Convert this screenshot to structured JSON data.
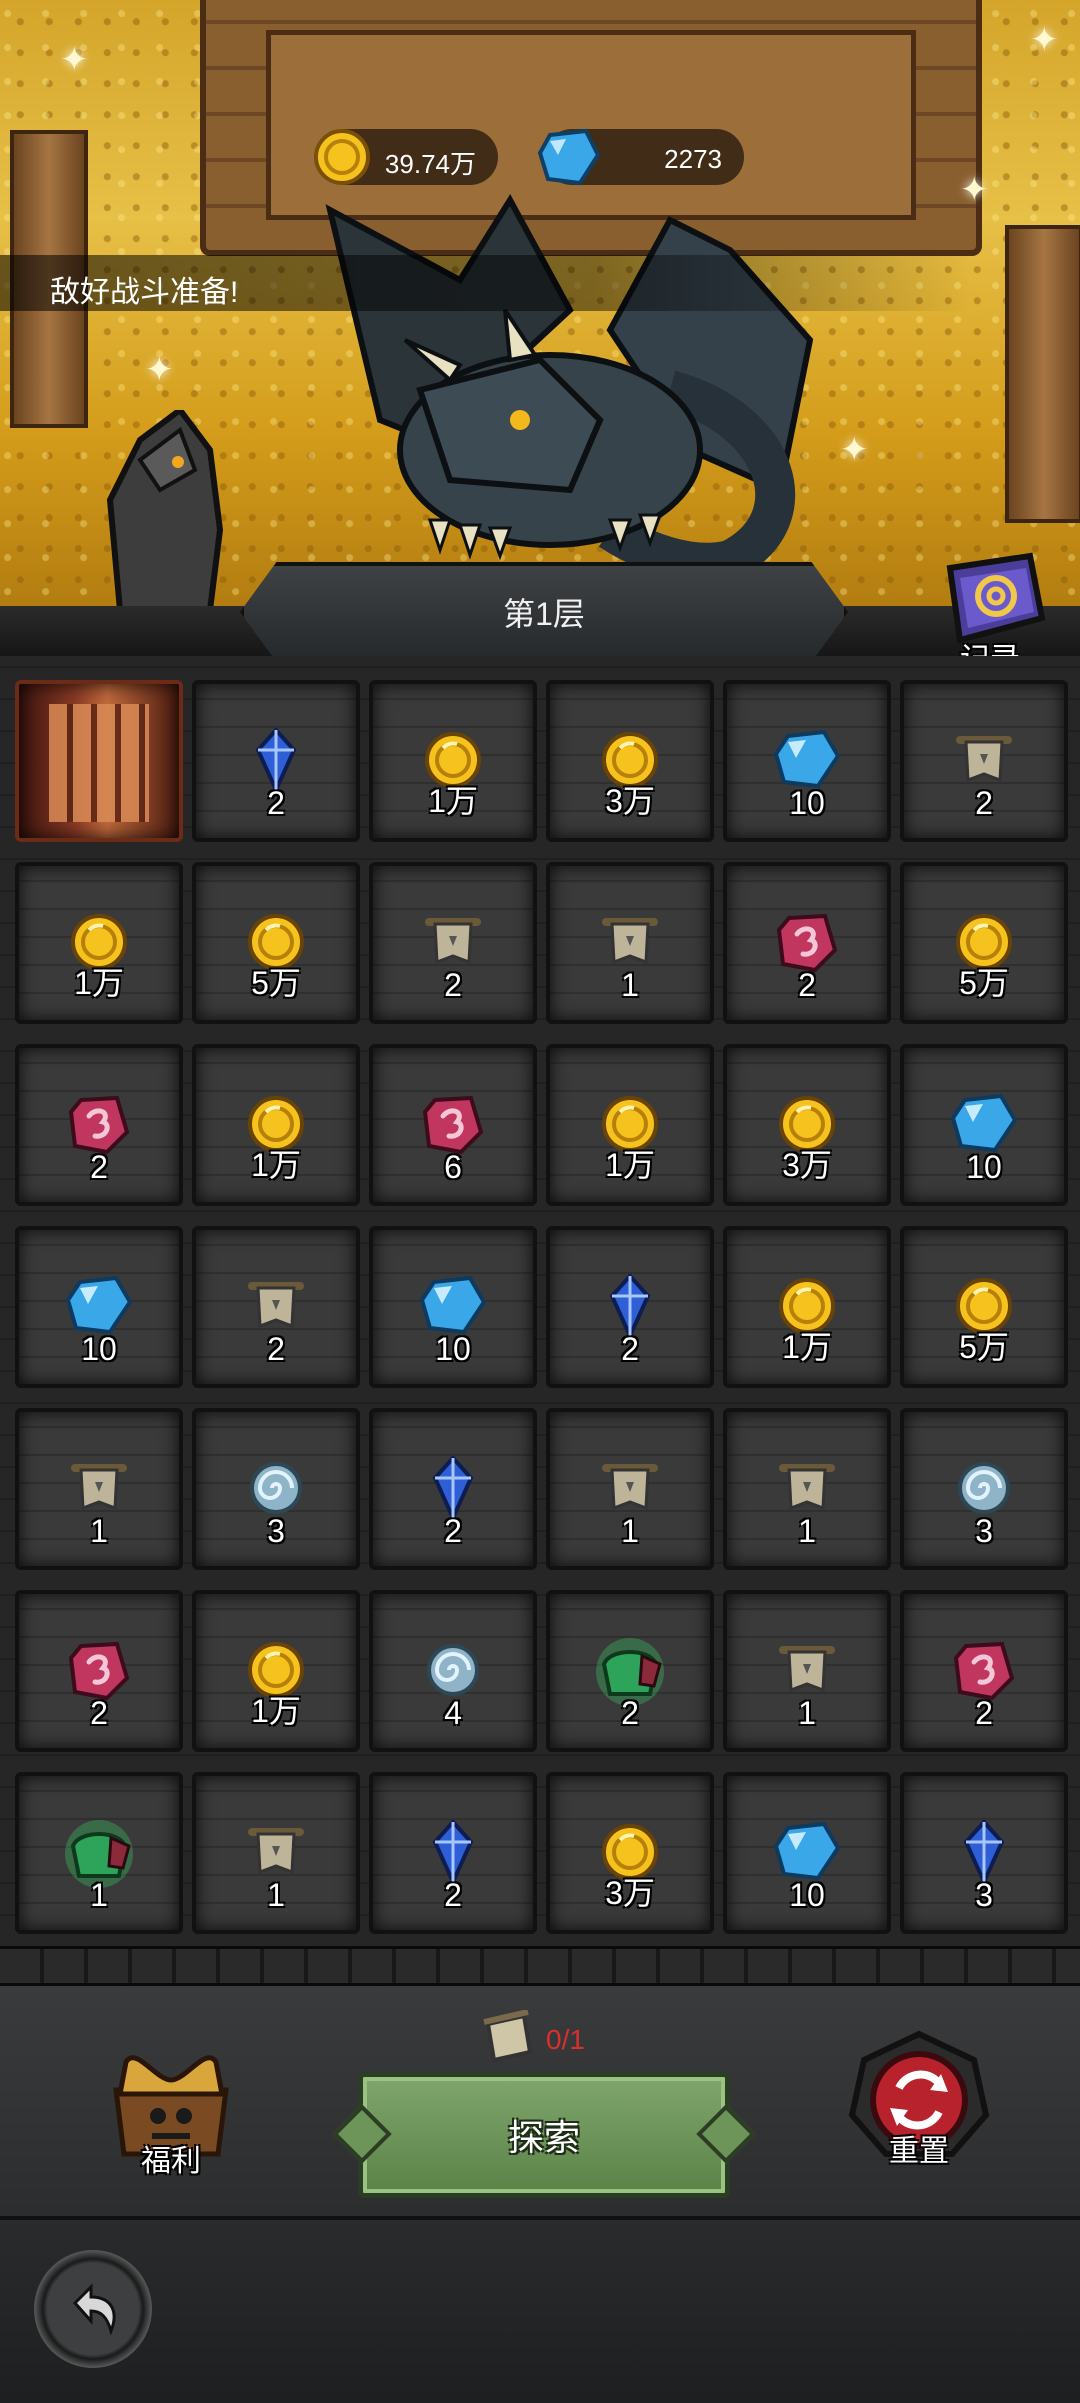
{
  "resources": {
    "gold": "39.74万",
    "gems": "2273"
  },
  "banner_text": "敌好战斗准备!",
  "floor_title": "第1层",
  "record_label": "记录",
  "grid": [
    [
      {
        "type": "door",
        "count": ""
      },
      {
        "type": "crystal",
        "count": "2"
      },
      {
        "type": "coin",
        "count": "1万"
      },
      {
        "type": "coin",
        "count": "3万"
      },
      {
        "type": "gem",
        "count": "10"
      },
      {
        "type": "scroll",
        "count": "2"
      }
    ],
    [
      {
        "type": "coin",
        "count": "1万"
      },
      {
        "type": "coin",
        "count": "5万"
      },
      {
        "type": "scroll",
        "count": "2"
      },
      {
        "type": "scroll",
        "count": "1"
      },
      {
        "type": "rune",
        "count": "2"
      },
      {
        "type": "coin",
        "count": "5万"
      }
    ],
    [
      {
        "type": "rune",
        "count": "2"
      },
      {
        "type": "coin",
        "count": "1万"
      },
      {
        "type": "rune",
        "count": "6"
      },
      {
        "type": "coin",
        "count": "1万"
      },
      {
        "type": "coin",
        "count": "3万"
      },
      {
        "type": "gem",
        "count": "10"
      }
    ],
    [
      {
        "type": "gem",
        "count": "10"
      },
      {
        "type": "scroll",
        "count": "2"
      },
      {
        "type": "gem",
        "count": "10"
      },
      {
        "type": "crystal",
        "count": "2"
      },
      {
        "type": "coin",
        "count": "1万"
      },
      {
        "type": "coin",
        "count": "5万"
      }
    ],
    [
      {
        "type": "scroll",
        "count": "1"
      },
      {
        "type": "swirl",
        "count": "3"
      },
      {
        "type": "crystal",
        "count": "2"
      },
      {
        "type": "scroll",
        "count": "1"
      },
      {
        "type": "scroll",
        "count": "1"
      },
      {
        "type": "swirl",
        "count": "3"
      }
    ],
    [
      {
        "type": "rune",
        "count": "2"
      },
      {
        "type": "coin",
        "count": "1万"
      },
      {
        "type": "swirl",
        "count": "4"
      },
      {
        "type": "bag",
        "count": "2"
      },
      {
        "type": "scroll",
        "count": "1"
      },
      {
        "type": "rune",
        "count": "2"
      }
    ],
    [
      {
        "type": "bag",
        "count": "1"
      },
      {
        "type": "scroll",
        "count": "1"
      },
      {
        "type": "crystal",
        "count": "2"
      },
      {
        "type": "coin",
        "count": "3万"
      },
      {
        "type": "gem",
        "count": "10"
      },
      {
        "type": "crystal",
        "count": "3"
      }
    ]
  ],
  "explore": {
    "scroll_requirement": "0/1",
    "label": "探索"
  },
  "welfare_label": "福利",
  "reset_label": "重置",
  "colors": {
    "gold": "#f2b81c",
    "gem": "#3aa7e8",
    "rune": "#c0365f",
    "explore": "#6d9559",
    "reset": "#b8222c"
  }
}
